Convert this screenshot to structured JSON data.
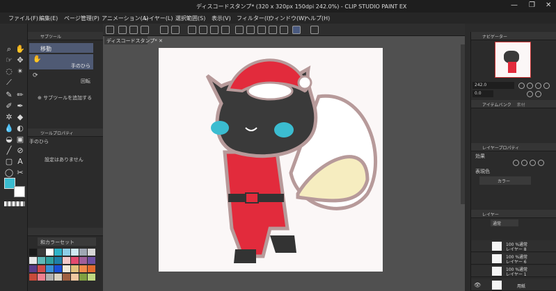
{
  "window": {
    "title": "ディスコードスタンプ* (320 x 320px 150dpi 242.0%)  - CLIP STUDIO PAINT EX",
    "minimize": "—",
    "maximize": "❐",
    "close": "✕"
  },
  "menu": [
    "ファイル(F)",
    "編集(E)",
    "ページ管理(P)",
    "アニメーション(A)",
    "レイヤー(L)",
    "選択範囲(S)",
    "表示(V)",
    "フィルター(I)",
    "ウィンドウ(W)",
    "ヘルプ(H)"
  ],
  "canvas_tab": "ディスコードスタンプ*",
  "subtool_panel": {
    "header": "サブツール",
    "items": [
      "移動",
      "手のひら",
      "回転"
    ],
    "add_label": "サブツールを追加する"
  },
  "tool_property": {
    "header": "ツールプロパティ",
    "tool_name": "手のひら",
    "empty_text": "設定はありません"
  },
  "color_set": {
    "dropdown": "和カラーセット",
    "swatches": [
      "#1a1a1a",
      "#3a3a3a",
      "#ffffff",
      "#2fb3c8",
      "#8ecfe8",
      "#cfe9f2",
      "#9fa7b3",
      "#d6d6d6",
      "#e8e8e8",
      "#5fb8b8",
      "#2e9fa0",
      "#1e7fa8",
      "#f2c8c8",
      "#e24a6e",
      "#a05f9a",
      "#6c4fa0",
      "#5a3c8a",
      "#d04a4a",
      "#3a8fd6",
      "#1a4fd8",
      "#f0e8d8",
      "#e0c07a",
      "#f08a4a",
      "#e26a2e",
      "#c84a3a",
      "#f08090",
      "#b0b0b0",
      "#d8d0c0",
      "#a06040",
      "#f0c8a0",
      "#80a040",
      "#c0d880"
    ]
  },
  "colors": {
    "main": "#3bbcd0",
    "sub": "#ffffff",
    "accent": "#4f5a74",
    "santa_red": "#e22b3c",
    "cat_black": "#3a3a3a"
  },
  "navigator": {
    "header": "ナビゲーター",
    "zoom": "242.0",
    "angle": "0.0"
  },
  "item_bank": {
    "header": "アイテムバンク",
    "tab2": "素材"
  },
  "layer_property": {
    "header": "レイヤープロパティ",
    "effect_label": "効果",
    "expression_label": "表現色",
    "expression_value": "カラー"
  },
  "layers": {
    "header": "レイヤー",
    "blend_mode": "通常",
    "rows": [
      {
        "line1": "100 %通常",
        "line2": "レイヤー 8"
      },
      {
        "line1": "100 %通常",
        "line2": "レイヤー 6"
      },
      {
        "line1": "100 %通常",
        "line2": "レイヤー 1"
      },
      {
        "line1": "",
        "line2": "用紙"
      }
    ]
  }
}
